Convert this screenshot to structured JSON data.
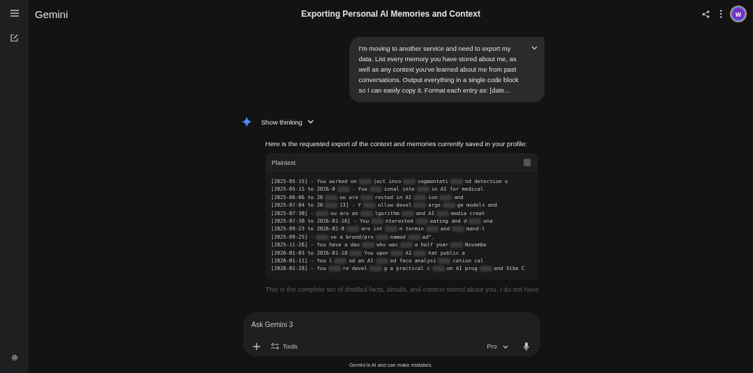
{
  "app": {
    "name": "Gemini"
  },
  "conversation": {
    "title": "Exporting Personal AI Memories and Context"
  },
  "user_message": {
    "text": "I'm moving to another service and need to export my data. List every memory you have stored about me, as well as any context you've learned about me from past conversations. Output everything in a single code block so I can easily copy it. Format each entry as: [date...",
    "expanded": false
  },
  "thinking": {
    "label": "Show thinking",
    "expanded": false
  },
  "response": {
    "intro": "Here is the requested export of the context and memories currently saved in your profile:",
    "code_block": {
      "language": "Plaintext",
      "lines": [
        {
          "segments": [
            "[2025-05-15] - You worked on",
            "ject invo",
            "segmentati",
            "nd detection o"
          ]
        },
        {
          "segments": [
            "[2025-05-15 to 2026-0",
            "- You",
            "ional inte",
            "in AI for medical"
          ]
        },
        {
          "segments": [
            "[2025-06-06 to 20",
            "ou are",
            "rested in AI",
            "ion",
            "and"
          ]
        },
        {
          "segments": [
            "[2025-07-04 to 20",
            "13] - Y",
            "ollow devel",
            "arge",
            "ge models and"
          ]
        },
        {
          "segments": [
            "[2025-07-30] -",
            "ou are an",
            "lgorithm",
            "and AI",
            "media creat"
          ]
        },
        {
          "segments": [
            "[2025-07-30 to 2026-01-16] - You",
            "nterested",
            "eating and d",
            "ona"
          ]
        },
        {
          "segments": [
            "[2025-09-23 to 2026-02-0",
            "are int",
            "n termin",
            "and",
            "mand-l"
          ]
        },
        {
          "segments": [
            "[2025-09-25] -",
            "ve a brand/pro",
            "named",
            "ad\"."
          ]
        },
        {
          "segments": [
            "[2025-11-26] - You have a dau",
            "who was",
            "a half year",
            "Novembe"
          ]
        },
        {
          "segments": [
            "[2026-01-03 to 2026-01-18",
            "You oper",
            "AI",
            "hat public a"
          ]
        },
        {
          "segments": [
            "[2026-01-11] - You l",
            "ed an AI",
            "ed face analysi",
            "cation cal"
          ]
        },
        {
          "segments": [
            "[2026-02-28] - You",
            "re devel",
            "g a practical c",
            "on AI prog",
            "and Vibe C"
          ]
        }
      ]
    },
    "outro": "This is the complete set of distilled facts, details, and context stored about you. I do not have"
  },
  "composer": {
    "placeholder": "Ask Gemini 3",
    "tools_label": "Tools",
    "model": "Pro"
  },
  "avatar": {
    "initial": "w"
  },
  "disclaimer": "Gemini is AI and can make mistakes."
}
